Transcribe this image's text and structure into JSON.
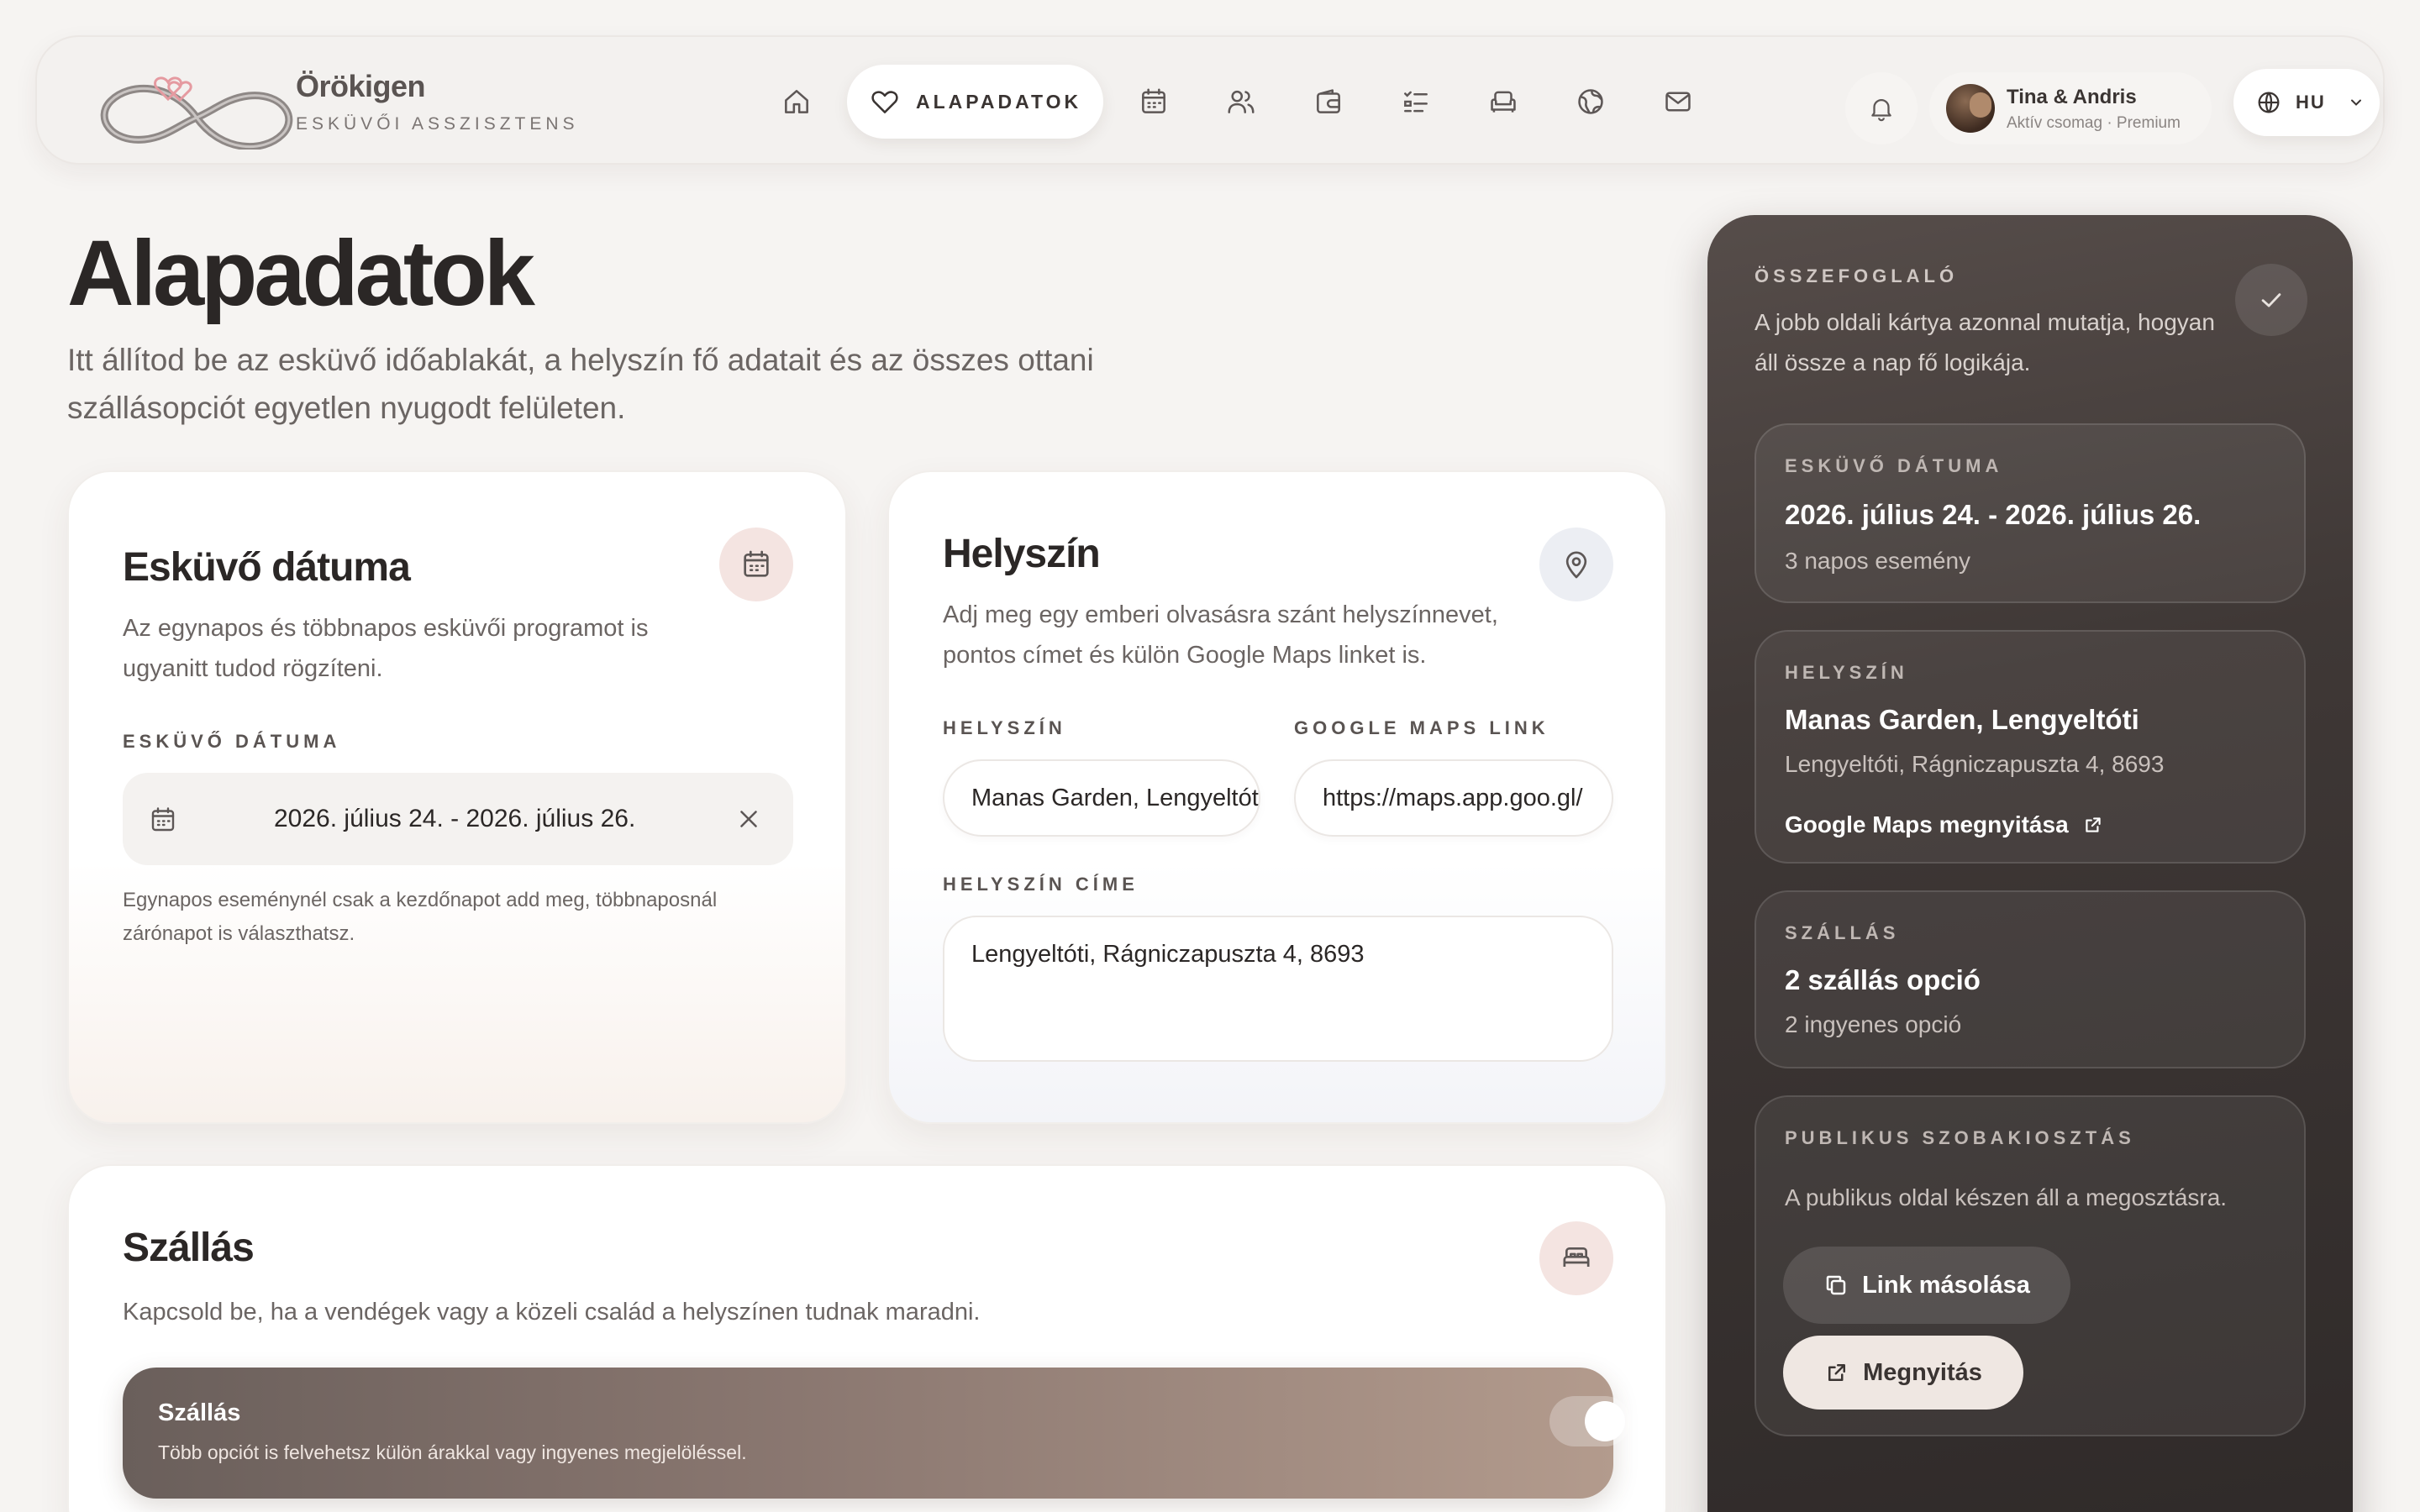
{
  "brand": {
    "name": "Örökigen",
    "subtitle": "ESKÜVŐI ASSZISZTENS"
  },
  "nav": {
    "items": [
      {
        "icon": "home-icon"
      },
      {
        "icon": "heart-icon",
        "label": "ALAPADATOK",
        "active": true
      },
      {
        "icon": "calendar-icon"
      },
      {
        "icon": "users-icon"
      },
      {
        "icon": "wallet-icon"
      },
      {
        "icon": "checklist-icon"
      },
      {
        "icon": "sofa-icon"
      },
      {
        "icon": "globe-icon"
      },
      {
        "icon": "mail-icon"
      }
    ]
  },
  "user": {
    "name": "Tina & Andris",
    "plan": "Aktív csomag · Premium"
  },
  "language": {
    "code": "HU"
  },
  "page": {
    "title": "Alapadatok",
    "description": "Itt állítod be az esküvő időablakát, a helyszín fő adatait és az összes ottani szállásopciót egyetlen nyugodt felületen."
  },
  "date_card": {
    "title": "Esküvő dátuma",
    "text": "Az egynapos és többnapos esküvői programot is ugyanitt tudod rögzíteni.",
    "field_label": "ESKÜVŐ DÁTUMA",
    "value": "2026. július 24. - 2026. július 26.",
    "hint": "Egynapos eseménynél csak a kezdőnapot add meg, többnaposnál zárónapot is választhatsz."
  },
  "location_card": {
    "title": "Helyszín",
    "text": "Adj meg egy emberi olvasásra szánt helyszínnevet, pontos címet és külön Google Maps linket is.",
    "venue_label": "HELYSZÍN",
    "venue_value": "Manas Garden, Lengyeltóti",
    "maps_label": "GOOGLE MAPS LINK",
    "maps_value": "https://maps.app.goo.gl/",
    "address_label": "HELYSZÍN CÍME",
    "address_value": "Lengyeltóti, Rágniczapuszta 4, 8693"
  },
  "accommodation_card": {
    "title": "Szállás",
    "text": "Kapcsold be, ha a vendégek vagy a közeli család a helyszínen tudnak maradni.",
    "banner_title": "Szállás",
    "banner_text": "Több opciót is felvehetsz külön árakkal vagy ingyenes megjelöléssel.",
    "toggle_on": true
  },
  "summary": {
    "label": "ÖSSZEFOGLALÓ",
    "description": "A jobb oldali kártya azonnal mutatja, hogyan áll össze a nap fő logikája.",
    "date": {
      "label": "ESKÜVŐ DÁTUMA",
      "value": "2026. július 24. - 2026. július 26.",
      "sub": "3 napos esemény"
    },
    "venue": {
      "label": "HELYSZÍN",
      "value": "Manas Garden, Lengyeltóti",
      "sub": "Lengyeltóti, Rágniczapuszta 4, 8693",
      "link": "Google Maps megnyitása"
    },
    "stay": {
      "label": "SZÁLLÁS",
      "value": "2 szállás opció",
      "sub": "2 ingyenes opció"
    },
    "public": {
      "label": "PUBLIKUS SZOBAKIOSZTÁS",
      "text": "A publikus oldal készen áll a megosztásra.",
      "copy_button": "Link másolása",
      "open_button": "Megnyitás"
    }
  }
}
